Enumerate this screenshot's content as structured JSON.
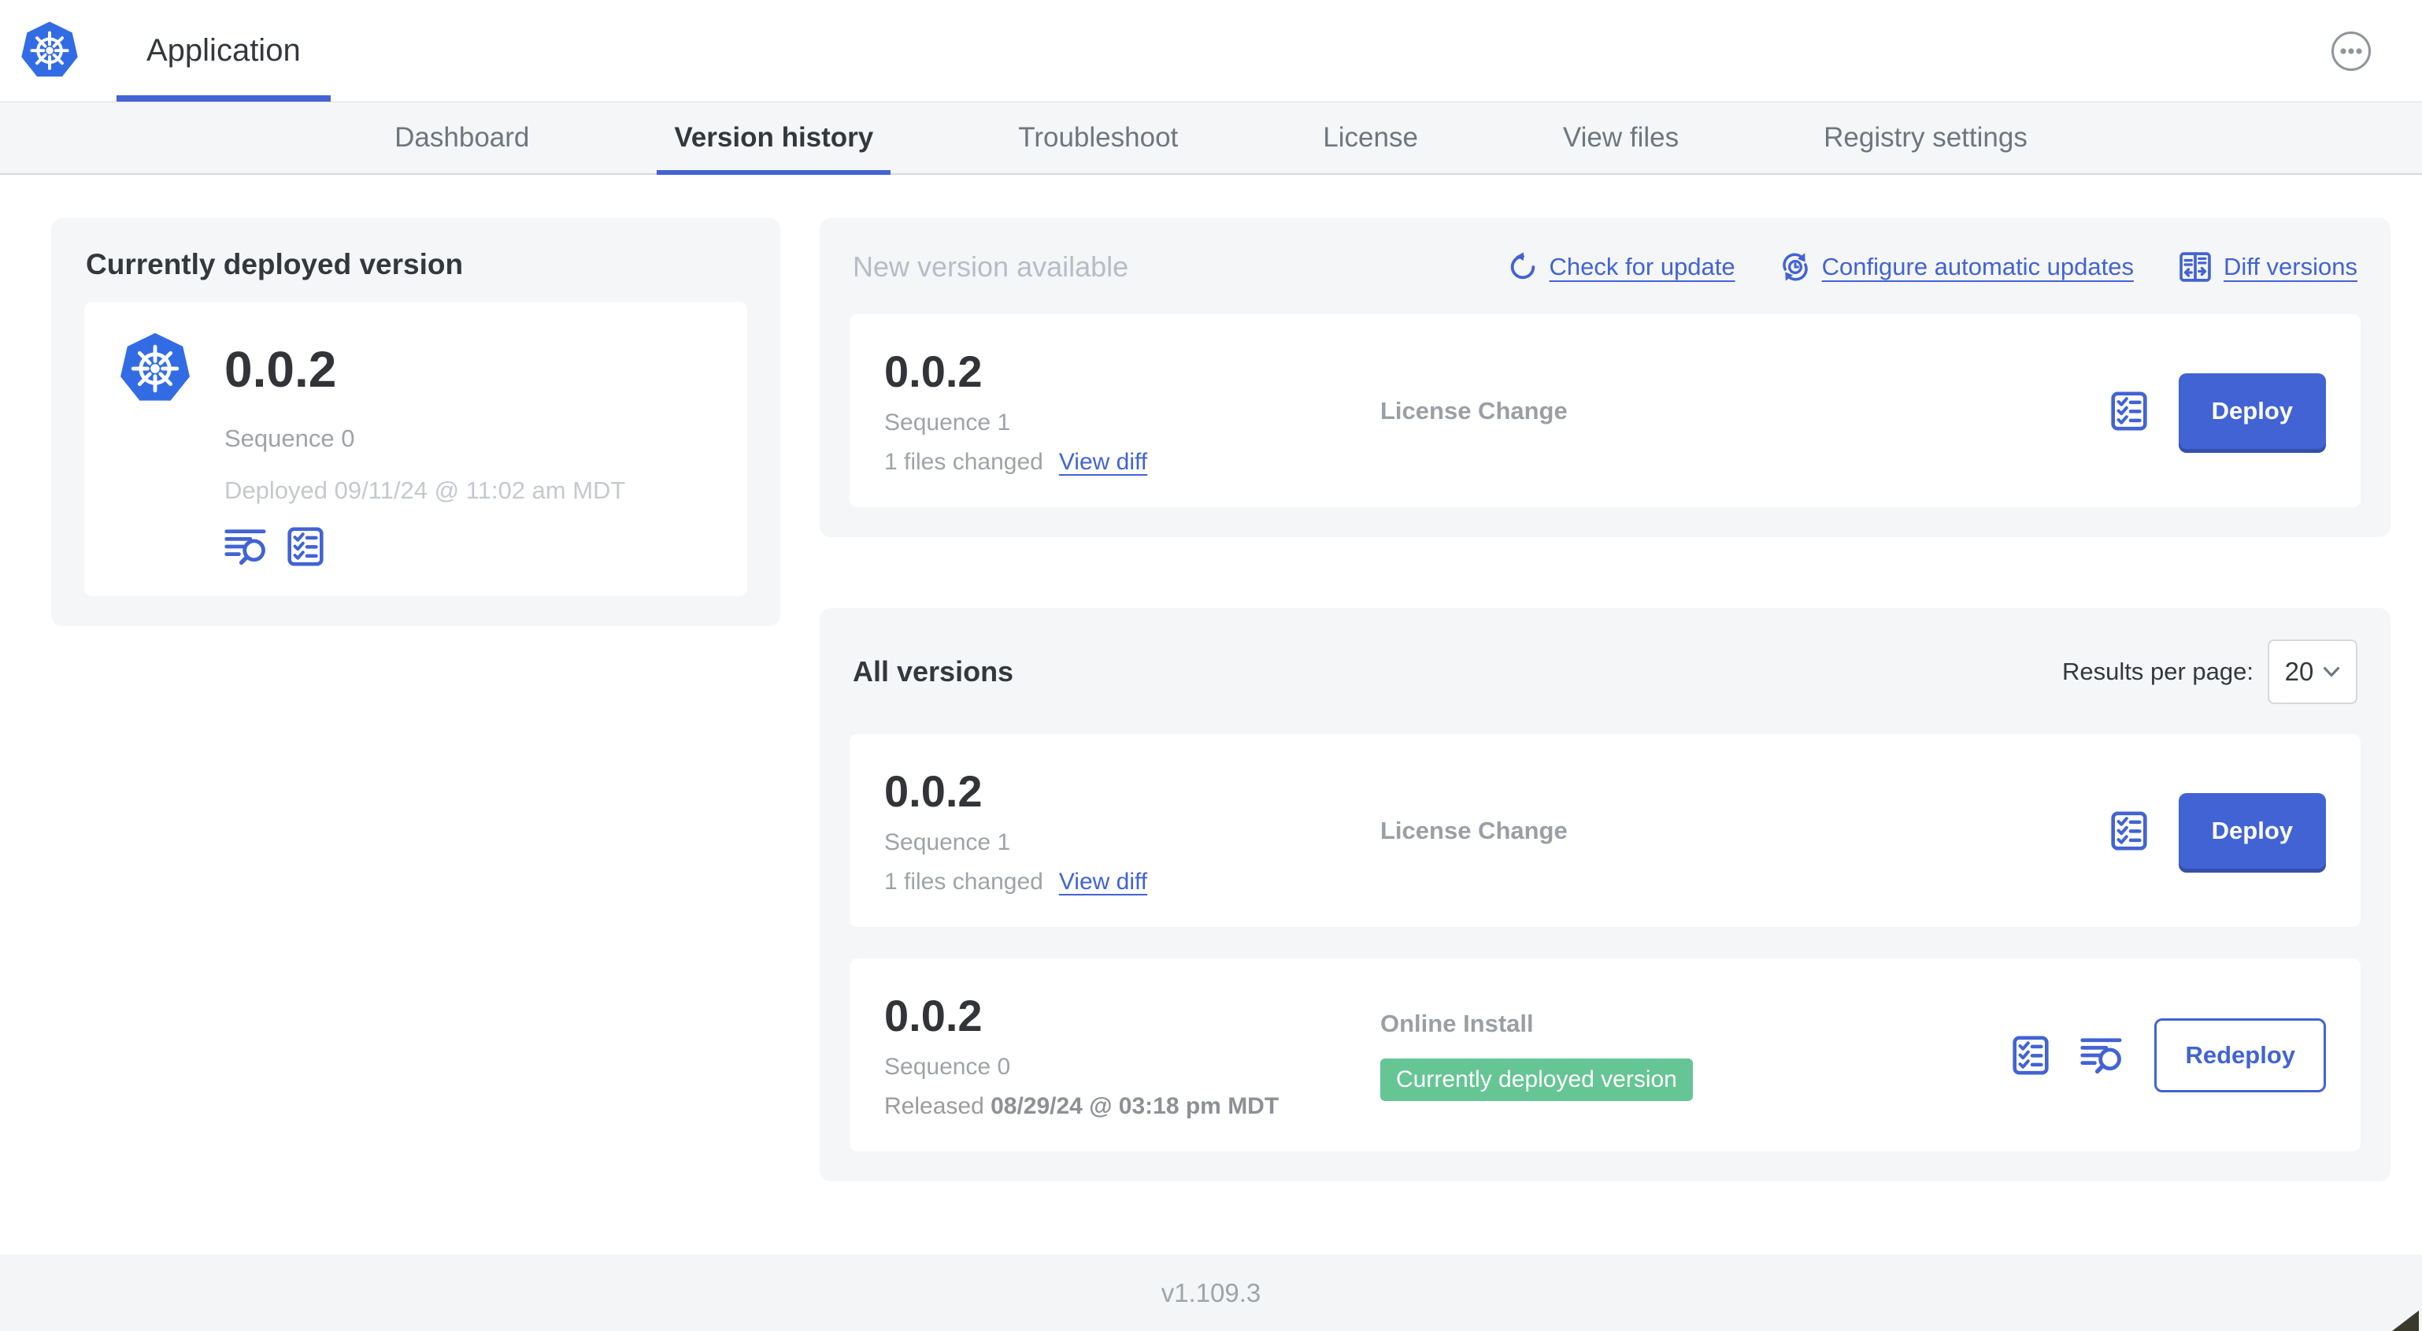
{
  "header": {
    "title": "Application"
  },
  "tabs": [
    {
      "label": "Dashboard"
    },
    {
      "label": "Version history"
    },
    {
      "label": "Troubleshoot"
    },
    {
      "label": "License"
    },
    {
      "label": "View files"
    },
    {
      "label": "Registry settings"
    }
  ],
  "deployed_card": {
    "title": "Currently deployed version",
    "version": "0.0.2",
    "sequence": "Sequence 0",
    "deployed_at": "Deployed 09/11/24 @ 11:02 am MDT"
  },
  "new_version": {
    "title": "New version available",
    "check_for_update": "Check for update",
    "configure_updates": "Configure automatic updates",
    "diff_versions": "Diff versions",
    "row": {
      "version": "0.0.2",
      "sequence": "Sequence 1",
      "files_changed": "1 files changed",
      "view_diff": "View diff",
      "source": "License Change",
      "deploy": "Deploy"
    }
  },
  "all_versions": {
    "title": "All versions",
    "results_label": "Results per page:",
    "results_value": "20",
    "rows": [
      {
        "version": "0.0.2",
        "sequence": "Sequence 1",
        "files_changed": "1 files changed",
        "view_diff": "View diff",
        "source": "License Change",
        "action": "Deploy"
      },
      {
        "version": "0.0.2",
        "sequence": "Sequence 0",
        "released_prefix": "Released ",
        "released_date": "08/29/24 @ 03:18 pm MDT",
        "source": "Online Install",
        "badge": "Currently deployed version",
        "action": "Redeploy"
      }
    ]
  },
  "footer": {
    "app_version": "v1.109.3"
  },
  "colors": {
    "accent": "#4263d4",
    "badge_green": "#66c594",
    "k8s_blue": "#326ce5"
  }
}
